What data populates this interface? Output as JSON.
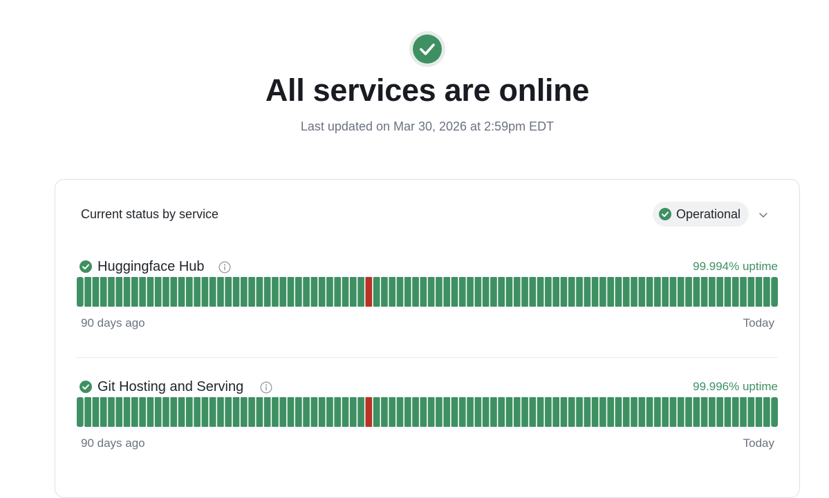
{
  "hero": {
    "title": "All services are online",
    "subtitle": "Last updated on Mar 30, 2026 at 2:59pm EDT",
    "icon": "check-circle-icon"
  },
  "card": {
    "header_title": "Current status by service",
    "filter": {
      "selected": "Operational",
      "icon": "check-circle-icon"
    }
  },
  "colors": {
    "operational": "#3e9063",
    "outage": "#b83225",
    "muted_text": "#6b7280"
  },
  "services": [
    {
      "name": "Huggingface Hub",
      "status": "operational",
      "uptime": "99.994% uptime",
      "range_start": "90 days ago",
      "range_end": "Today",
      "outage_days": [
        37
      ]
    },
    {
      "name": "Git Hosting and Serving",
      "status": "operational",
      "uptime": "99.996% uptime",
      "range_start": "90 days ago",
      "range_end": "Today",
      "outage_days": [
        37
      ]
    }
  ]
}
